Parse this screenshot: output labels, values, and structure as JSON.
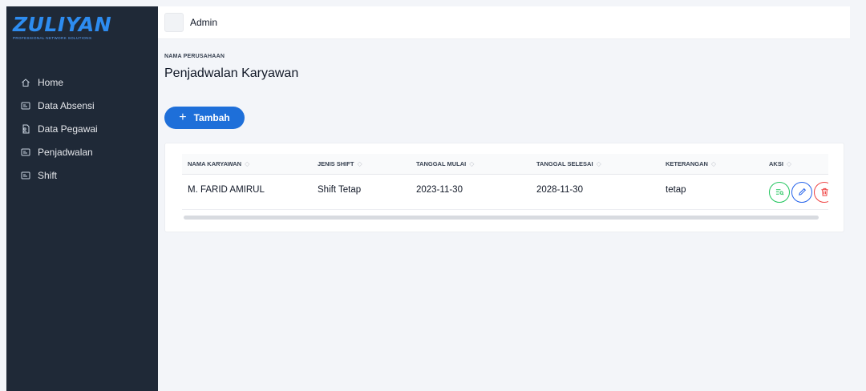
{
  "brand": {
    "name": "ZULIYAN",
    "tagline": "PROFESSIONAL NETWORK SOLUTIONS"
  },
  "sidebar": {
    "items": [
      {
        "label": "Home",
        "icon": "home-icon"
      },
      {
        "label": "Data Absensi",
        "icon": "id-card-icon"
      },
      {
        "label": "Data Pegawai",
        "icon": "user-file-icon"
      },
      {
        "label": "Penjadwalan",
        "icon": "id-card-icon"
      },
      {
        "label": "Shift",
        "icon": "id-card-icon"
      }
    ]
  },
  "header": {
    "user": "Admin"
  },
  "page": {
    "company_label": "NAMA PERUSAHAAN",
    "title": "Penjadwalan Karyawan"
  },
  "toolbar": {
    "add_label": "Tambah"
  },
  "table": {
    "columns": [
      "NAMA KARYAWAN",
      "JENIS SHIFT",
      "TANGGAL MULAI",
      "TANGGAL SELESAI",
      "KETERANGAN",
      "AKSI"
    ],
    "rows": [
      {
        "nama": "M. FARID AMIRUL",
        "shift": "Shift Tetap",
        "mulai": "2023-11-30",
        "selesai": "2028-11-30",
        "keterangan": "tetap"
      }
    ]
  },
  "colors": {
    "sidebar": "#1f2937",
    "accent": "#1e6fd9",
    "view": "#22c55e",
    "edit": "#2563eb",
    "delete": "#ef4444"
  }
}
